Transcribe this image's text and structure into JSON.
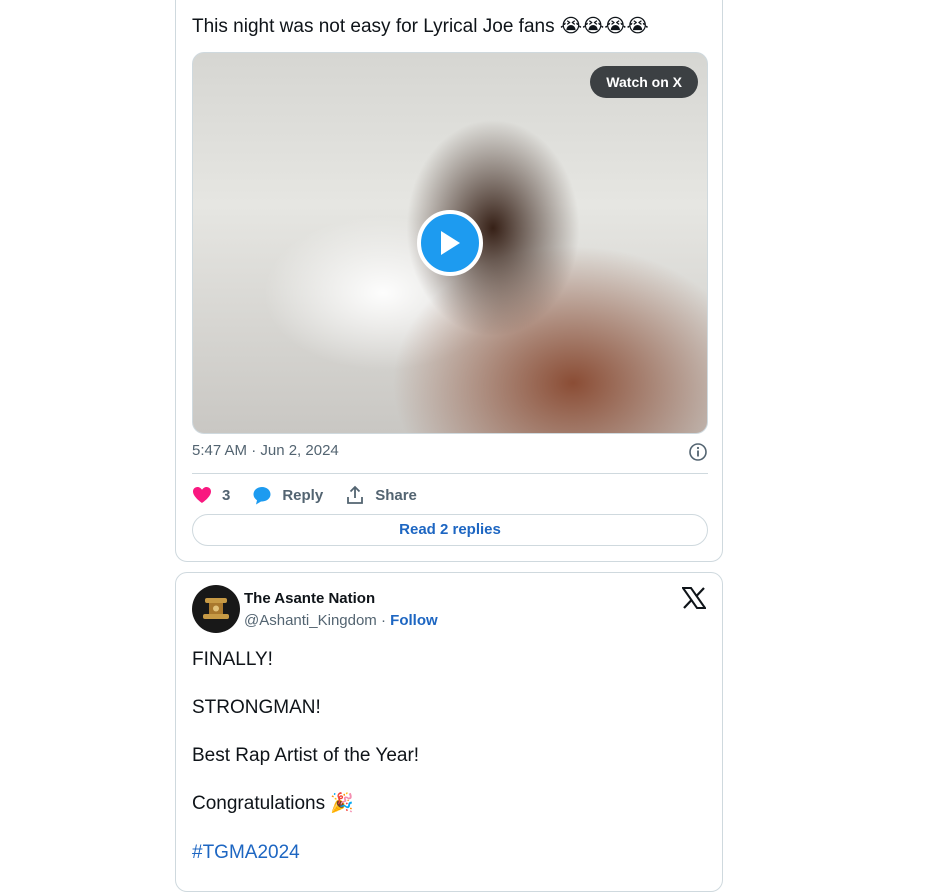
{
  "tweet1": {
    "text": "This night was not easy for Lyrical Joe fans",
    "emojis": "😭😭😭😭",
    "media": {
      "watch_label": "Watch on X"
    },
    "timestamp": "5:47 AM · Jun 2, 2024",
    "likes": "3",
    "reply_label": "Reply",
    "share_label": "Share",
    "read_replies_label": "Read 2 replies"
  },
  "tweet2": {
    "author_name": "The Asante Nation",
    "handle": "@Ashanti_Kingdom",
    "separator": "·",
    "follow_label": "Follow",
    "lines": [
      "FINALLY!",
      "STRONGMAN!",
      "Best Rap Artist of the Year!",
      "Congratulations",
      "#TGMA2024"
    ],
    "celebration_emoji": "🎉"
  },
  "colors": {
    "link": "#1d66c2",
    "play": "#1d9bf0",
    "like": "#f91880",
    "border": "#cfd9de"
  }
}
